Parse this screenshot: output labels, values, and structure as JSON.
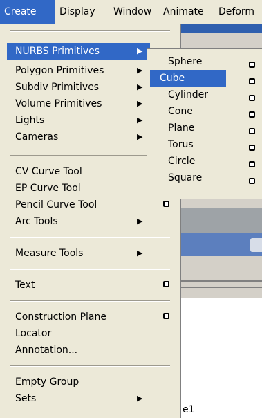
{
  "menubar": {
    "items": [
      "Create",
      "Display",
      "Window",
      "Animate",
      "Deform"
    ]
  },
  "create_menu": {
    "items": [
      {
        "label": "NURBS Primitives",
        "submenu": true,
        "selected": true
      },
      {
        "label": "Polygon Primitives",
        "submenu": true
      },
      {
        "label": "Subdiv Primitives",
        "submenu": true
      },
      {
        "label": "Volume Primitives",
        "submenu": true
      },
      {
        "label": "Lights",
        "submenu": true
      },
      {
        "label": "Cameras",
        "submenu": true
      },
      {
        "label": "CV Curve Tool"
      },
      {
        "label": "EP Curve Tool"
      },
      {
        "label": "Pencil Curve Tool",
        "option_box": true
      },
      {
        "label": "Arc Tools",
        "submenu": true
      },
      {
        "label": "Measure Tools",
        "submenu": true
      },
      {
        "label": "Text",
        "option_box": true
      },
      {
        "label": "Construction Plane",
        "option_box": true
      },
      {
        "label": "Locator"
      },
      {
        "label": "Annotation..."
      },
      {
        "label": "Empty Group"
      },
      {
        "label": "Sets",
        "submenu": true
      }
    ]
  },
  "nurbs_submenu": {
    "items": [
      "Sphere",
      "Cube",
      "Cylinder",
      "Cone",
      "Plane",
      "Torus",
      "Circle",
      "Square"
    ],
    "selected": "Cube"
  },
  "background": {
    "fragment_text": "e1"
  },
  "colors": {
    "selection": "#3168c6",
    "menu_bg": "#ece9d8"
  }
}
